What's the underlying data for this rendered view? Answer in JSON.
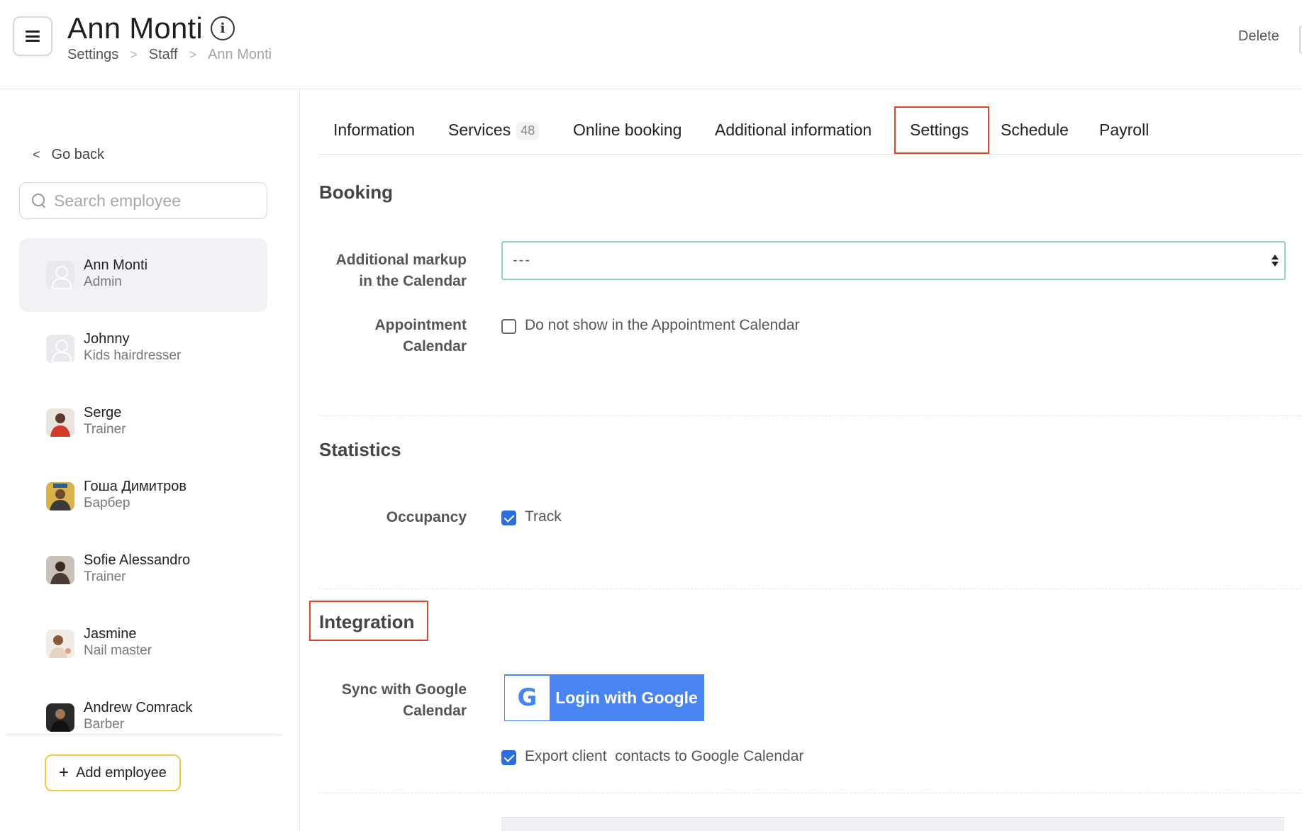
{
  "header": {
    "title": "Ann Monti",
    "info_icon": "info-icon",
    "breadcrumb": [
      "Settings",
      "Staff",
      "Ann Monti"
    ],
    "delete_label": "Delete",
    "menu_icon": "menu-icon"
  },
  "sidebar": {
    "go_back": "Go back",
    "search_placeholder": "Search employee",
    "employees": [
      {
        "name": "Ann Monti",
        "role": "Admin",
        "active": true
      },
      {
        "name": "Johnny",
        "role": "Kids hairdresser"
      },
      {
        "name": "Serge",
        "role": "Trainer"
      },
      {
        "name": "Гоша Димитров",
        "role": "Барбер"
      },
      {
        "name": "Sofie Alessandro",
        "role": "Trainer"
      },
      {
        "name": "Jasmine",
        "role": "Nail master"
      },
      {
        "name": "Andrew Comrack",
        "role": "Barber"
      }
    ],
    "add_employee": "Add employee",
    "add_icon": "+"
  },
  "tabs": [
    {
      "label": "Information"
    },
    {
      "label": "Services",
      "count": "48"
    },
    {
      "label": "Online booking"
    },
    {
      "label": "Additional information"
    },
    {
      "label": "Settings",
      "active": true
    },
    {
      "label": "Schedule"
    },
    {
      "label": "Payroll"
    }
  ],
  "booking": {
    "title": "Booking",
    "markup_label_1": "Additional markup",
    "markup_label_2": "in the Calendar",
    "markup_value": "---",
    "appointment_label_1": "Appointment",
    "appointment_label_2": "Calendar",
    "appointment_checkbox": "Do not show in the Appointment Calendar"
  },
  "statistics": {
    "title": "Statistics",
    "occupancy_label": "Occupancy",
    "track_checkbox": "Track"
  },
  "integration": {
    "title": "Integration",
    "sync_label_1": "Sync with Google",
    "sync_label_2": "Calendar",
    "google_button": "Login with Google",
    "google_letter": "G",
    "export_checkbox": "Export client  contacts to Google Calendar"
  },
  "colors": {
    "highlight": "#e0442a",
    "accent_blue": "#4a84f0",
    "select_border": "#8fd3b6",
    "add_border": "#f2c744"
  }
}
